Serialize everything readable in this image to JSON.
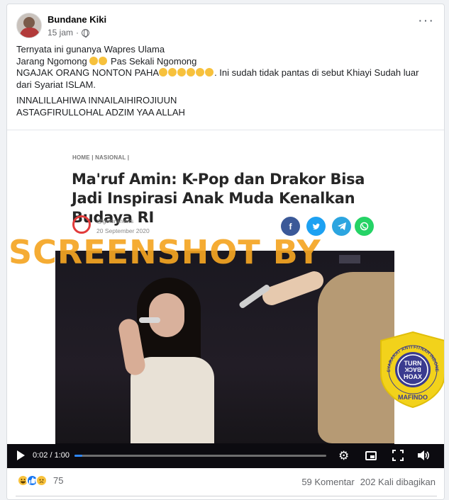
{
  "post": {
    "author": "Bundane Kiki",
    "time": "15 jam",
    "more_glyph": "···",
    "text": {
      "line1": "Ternyata ini gunanya Wapres Ulama",
      "line2_a": "Jarang Ngomong",
      "line2_b": "Pas Sekali Ngomong",
      "line3_a": "NGAJAK ORANG NONTON PAHA",
      "line3_b": ". Ini sudah tidak pantas di sebut Khiayi Sudah luar dari Syariat ISLAM.",
      "line4": "INNALILLAHIWA INNAILAIHIROJIUUN",
      "line5": "ASTAGFIRULLOHAL ADZIM YAA ALLAH"
    }
  },
  "article": {
    "breadcrumb": "HOME | NASIONAL |",
    "headline": "Ma'ruf Amin: K-Pop dan Drakor Bisa Jadi Inspirasi Anak Muda Kenalkan Budaya RI",
    "source": "@geloranews",
    "date": "20 September 2020",
    "share_icons": [
      "facebook-icon",
      "twitter-icon",
      "telegram-icon",
      "whatsapp-icon"
    ]
  },
  "watermark": "SCREENSHOT BY",
  "badge": {
    "ring_text": "MASYARAKAT ANTI FITNAH INDONESIA",
    "inner_1": "TURN",
    "inner_2": "BACK",
    "inner_3": "HOAX",
    "bottom": "MAFINDO"
  },
  "video": {
    "time": "0:02 / 1:00",
    "progress": 0.03
  },
  "footer": {
    "reaction_count": "75",
    "comments": "59 Komentar",
    "shares": "202 Kali dibagikan"
  },
  "colors": {
    "watermark": "#f5a623",
    "badge": "#f2d21b",
    "badge_inner": "#3a3b8f",
    "accent": "#2d88ff"
  }
}
